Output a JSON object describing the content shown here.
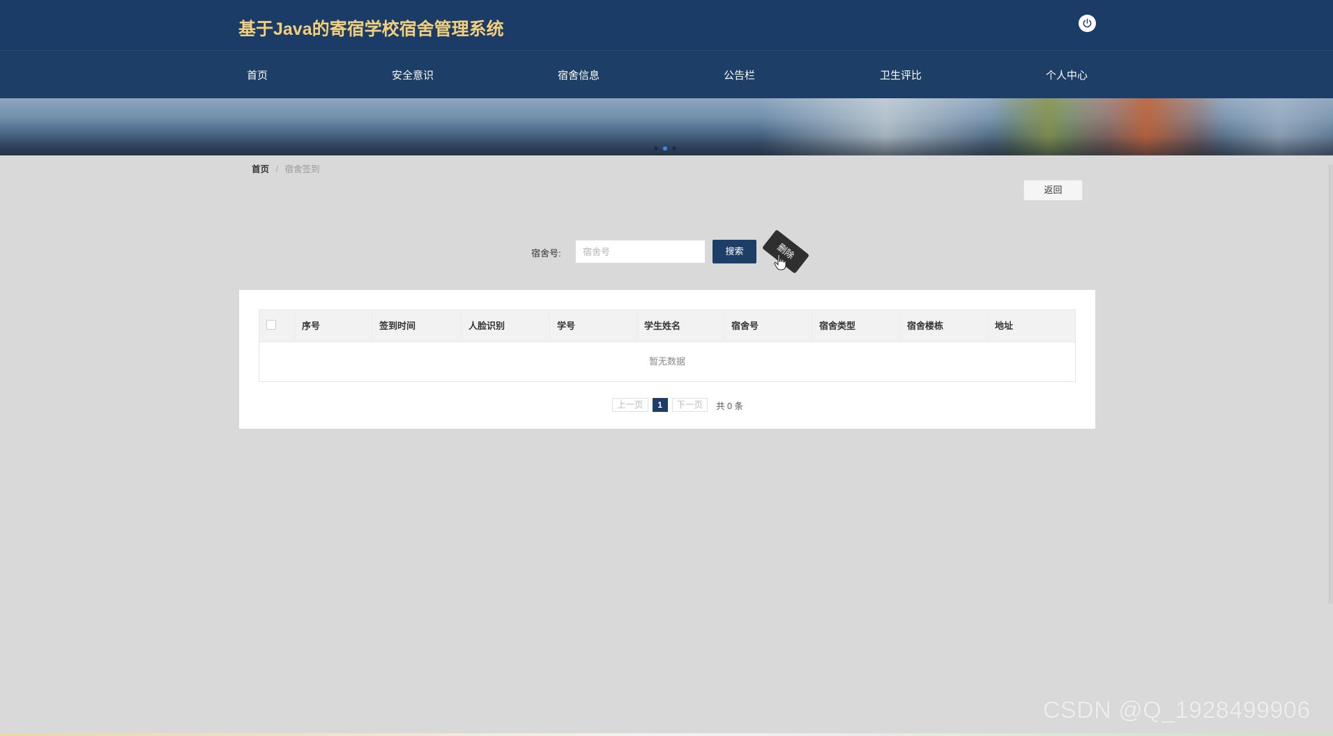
{
  "header": {
    "title": "基于Java的寄宿学校宿舍管理系统",
    "power_icon": "power-icon"
  },
  "nav": {
    "items": [
      {
        "label": "首页"
      },
      {
        "label": "安全意识"
      },
      {
        "label": "宿舍信息"
      },
      {
        "label": "公告栏"
      },
      {
        "label": "卫生评比"
      },
      {
        "label": "个人中心"
      }
    ]
  },
  "banner": {
    "slide_count": 3,
    "active_slide": 2
  },
  "breadcrumb": {
    "home": "首页",
    "separator": "/",
    "current": "宿舍签到"
  },
  "actions": {
    "back_label": "返回"
  },
  "search": {
    "label": "宿舍号:",
    "placeholder": "宿舍号",
    "value": "",
    "search_label": "搜索",
    "delete_label": "删除"
  },
  "table": {
    "columns": [
      "序号",
      "签到时间",
      "人脸识别",
      "学号",
      "学生姓名",
      "宿舍号",
      "宿舍类型",
      "宿舍楼栋",
      "地址"
    ],
    "rows": [],
    "empty_text": "暂无数据"
  },
  "pagination": {
    "prev_label": "上一页",
    "current_page": "1",
    "next_label": "下一页",
    "total_text": "共 0 条"
  },
  "watermark": "CSDN @Q_1928499906",
  "colors": {
    "header_bg": "#1b3c66",
    "title_color": "#f2cf7d",
    "primary": "#1c3e67",
    "page_bg": "#d9d9d9"
  }
}
